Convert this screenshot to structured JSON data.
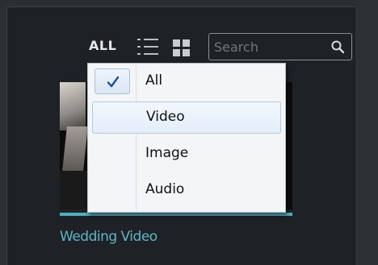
{
  "toolbar": {
    "filter_label": "ALL",
    "list_view_icon": "list-view-icon",
    "grid_view_icon": "grid-view-icon"
  },
  "search": {
    "placeholder": "Search",
    "value": "",
    "icon": "search-icon"
  },
  "media_filter_menu": {
    "selected": "All",
    "items": [
      {
        "label": "All",
        "checked": true
      },
      {
        "label": "Video",
        "checked": false,
        "hovered": true
      },
      {
        "label": "Image",
        "checked": false
      },
      {
        "label": "Audio",
        "checked": false
      }
    ]
  },
  "media_item": {
    "title": "Wedding Video"
  },
  "colors": {
    "background": "#1e2226",
    "accent": "#5bb7c8",
    "menu_background": "#f4f5f7",
    "menu_hover": "#e3edf9",
    "check": "#1a4fa3"
  }
}
